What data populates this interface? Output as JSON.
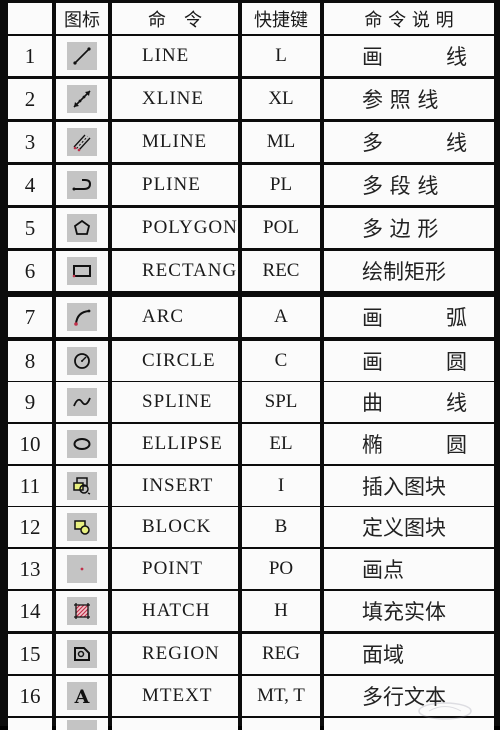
{
  "header": {
    "index": "",
    "icon": "图标",
    "command": "命　令",
    "shortcut": "快捷键",
    "description": "命 令 说 明"
  },
  "rows": [
    {
      "index": "1",
      "icon": "line-icon",
      "command": "LINE",
      "shortcut": "L",
      "description": "画　　　线"
    },
    {
      "index": "2",
      "icon": "xline-icon",
      "command": "XLINE",
      "shortcut": "XL",
      "description": "参 照 线"
    },
    {
      "index": "3",
      "icon": "mline-icon",
      "command": "MLINE",
      "shortcut": "ML",
      "description": "多　　　线"
    },
    {
      "index": "4",
      "icon": "pline-icon",
      "command": "PLINE",
      "shortcut": "PL",
      "description": "多 段 线"
    },
    {
      "index": "5",
      "icon": "polygon-icon",
      "command": "POLYGON",
      "shortcut": "POL",
      "description": "多 边 形"
    },
    {
      "index": "6",
      "icon": "rectangle-icon",
      "command": "RECTANG",
      "shortcut": "REC",
      "description": "绘制矩形"
    },
    {
      "index": "7",
      "icon": "arc-icon",
      "command": "ARC",
      "shortcut": "A",
      "description": "画　　　弧"
    },
    {
      "index": "8",
      "icon": "circle-icon",
      "command": "CIRCLE",
      "shortcut": "C",
      "description": "画　　　圆"
    },
    {
      "index": "9",
      "icon": "spline-icon",
      "command": "SPLINE",
      "shortcut": "SPL",
      "description": "曲　　　线"
    },
    {
      "index": "10",
      "icon": "ellipse-icon",
      "command": "ELLIPSE",
      "shortcut": "EL",
      "description": "椭　　　圆"
    },
    {
      "index": "11",
      "icon": "insert-block-icon",
      "command": "INSERT",
      "shortcut": "I",
      "description": "插入图块"
    },
    {
      "index": "12",
      "icon": "make-block-icon",
      "command": "BLOCK",
      "shortcut": "B",
      "description": "定义图块"
    },
    {
      "index": "13",
      "icon": "point-icon",
      "command": "POINT",
      "shortcut": "PO",
      "description": "画点"
    },
    {
      "index": "14",
      "icon": "hatch-icon",
      "command": "HATCH",
      "shortcut": "H",
      "description": "填充实体"
    },
    {
      "index": "15",
      "icon": "region-icon",
      "command": "REGION",
      "shortcut": "REG",
      "description": "面域"
    },
    {
      "index": "16",
      "icon": "mtext-icon",
      "command": "MTEXT",
      "shortcut": "MT, T",
      "description": "多行文本"
    }
  ],
  "colors": {
    "grid_line": "#0c0c0c",
    "cell_bg": "#fbfbfb",
    "icon_bg": "#c4c4c4",
    "icon_accent": "#c0304a"
  }
}
